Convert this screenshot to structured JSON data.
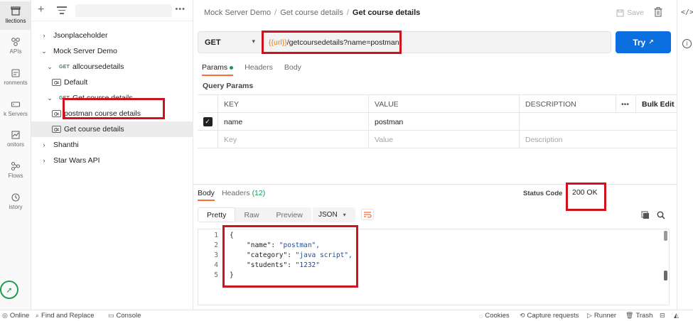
{
  "rail": {
    "items": [
      {
        "label": "llections",
        "icon": "collections-icon"
      },
      {
        "label": "APIs",
        "icon": "apis-icon"
      },
      {
        "label": "ronments",
        "icon": "environments-icon"
      },
      {
        "label": "k Servers",
        "icon": "mock-servers-icon"
      },
      {
        "label": "onitors",
        "icon": "monitors-icon"
      },
      {
        "label": "Flows",
        "icon": "flows-icon"
      },
      {
        "label": "istory",
        "icon": "history-icon"
      }
    ]
  },
  "sidebar": {
    "more": "•••",
    "tree": [
      {
        "label": "Jsonplaceholder",
        "chevron": "›",
        "method": "",
        "kind": "collection",
        "indent": 0,
        "selected": false
      },
      {
        "label": "Mock Server Demo",
        "chevron": "⌄",
        "method": "",
        "kind": "collection",
        "indent": 0,
        "selected": false
      },
      {
        "label": "allcoursedetails",
        "chevron": "⌄",
        "method": "GET",
        "kind": "request",
        "indent": 1,
        "selected": false
      },
      {
        "label": "Default",
        "chevron": "",
        "method": "",
        "kind": "example",
        "indent": 2,
        "selected": false
      },
      {
        "label": "Get course details",
        "chevron": "⌄",
        "method": "GET",
        "kind": "request",
        "indent": 1,
        "selected": false
      },
      {
        "label": "postman course details",
        "chevron": "",
        "method": "",
        "kind": "example",
        "indent": 2,
        "selected": false
      },
      {
        "label": "Get course details",
        "chevron": "",
        "method": "",
        "kind": "example",
        "indent": 2,
        "selected": true
      },
      {
        "label": "Shanthi",
        "chevron": "›",
        "method": "",
        "kind": "collection",
        "indent": 0,
        "selected": false
      },
      {
        "label": "Star Wars API",
        "chevron": "›",
        "method": "",
        "kind": "collection",
        "indent": 0,
        "selected": false
      }
    ]
  },
  "header": {
    "crumb_1": "Mock Server Demo",
    "crumb_2": "Get course details",
    "crumb_3": "Get course details",
    "separator": "/",
    "save_label": "Save"
  },
  "request": {
    "method": "GET",
    "url_var": "{{url}}",
    "url_path": "/getcoursedetails?name=postman",
    "send_label": "Try",
    "send_arrow": "↗",
    "tabs": [
      "Params",
      "Headers",
      "Body"
    ],
    "query_params_title": "Query Params",
    "columns": {
      "key": "KEY",
      "value": "VALUE",
      "description": "DESCRIPTION",
      "more": "•••",
      "bulk": "Bulk Edit"
    },
    "params": [
      {
        "key": "name",
        "value": "postman",
        "description": ""
      }
    ],
    "placeholder": {
      "key": "Key",
      "value": "Value",
      "description": "Description"
    }
  },
  "response": {
    "tab_body": "Body",
    "tab_headers": "Headers",
    "headers_count": "(12)",
    "status_label": "Status Code",
    "status_value": "200 OK",
    "views": [
      "Pretty",
      "Raw",
      "Preview"
    ],
    "format": "JSON",
    "lines": [
      {
        "n": "1",
        "text": "{"
      },
      {
        "n": "2",
        "key": "\"name\"",
        "val": "\"postman\","
      },
      {
        "n": "3",
        "key": "\"category\"",
        "val": "\"java script\","
      },
      {
        "n": "4",
        "key": "\"students\"",
        "val": "\"1232\""
      },
      {
        "n": "5",
        "text": "}"
      }
    ]
  },
  "footer": {
    "online": "Online",
    "find_replace": "Find and Replace",
    "console": "Console",
    "cookies": "Cookies",
    "capture": "Capture requests",
    "runner": "Runner",
    "trash": "Trash"
  },
  "colors": {
    "accent": "#ff6c37",
    "send": "#0b6fe0",
    "get": "#0f9d58",
    "annotation": "#d0121f",
    "url_var": "#e67e22"
  }
}
